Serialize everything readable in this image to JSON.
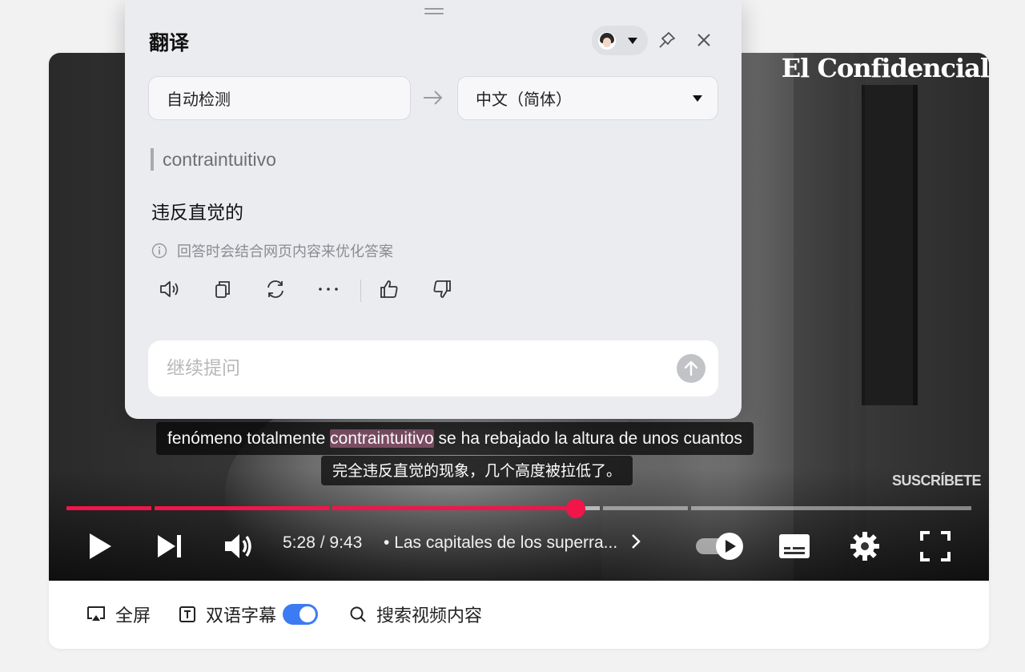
{
  "panel": {
    "title": "翻译",
    "source_lang": "自动检测",
    "target_lang": "中文（简体）",
    "source_text": "contraintuitivo",
    "translation": "违反直觉的",
    "note": "回答时会结合网页内容来优化答案",
    "ask_placeholder": "继续提问",
    "ask_value": ""
  },
  "video": {
    "logo": "El Confidencial",
    "subscribe": "SUSCRÍBETE",
    "caption_line1_before": "fenómeno totalmente ",
    "caption_line1_highlight": "contraintuitivo",
    "caption_line1_after": " se ha rebajado la altura de unos cuantos",
    "caption_line2": "完全违反直觉的现象，几个高度被拉低了。",
    "current_time": "5:28",
    "separator": " / ",
    "duration": "9:43",
    "chapter": "Las capitales de los superra...",
    "progress_fraction": 0.564,
    "accent_color": "#f2154a"
  },
  "toolbar": {
    "fullscreen": "全屏",
    "bilingual": "双语字幕",
    "bilingual_on": true,
    "search": "搜索视频内容"
  },
  "colors": {
    "toggle_on": "#3d7bf2",
    "highlight": "#7b4e63"
  }
}
